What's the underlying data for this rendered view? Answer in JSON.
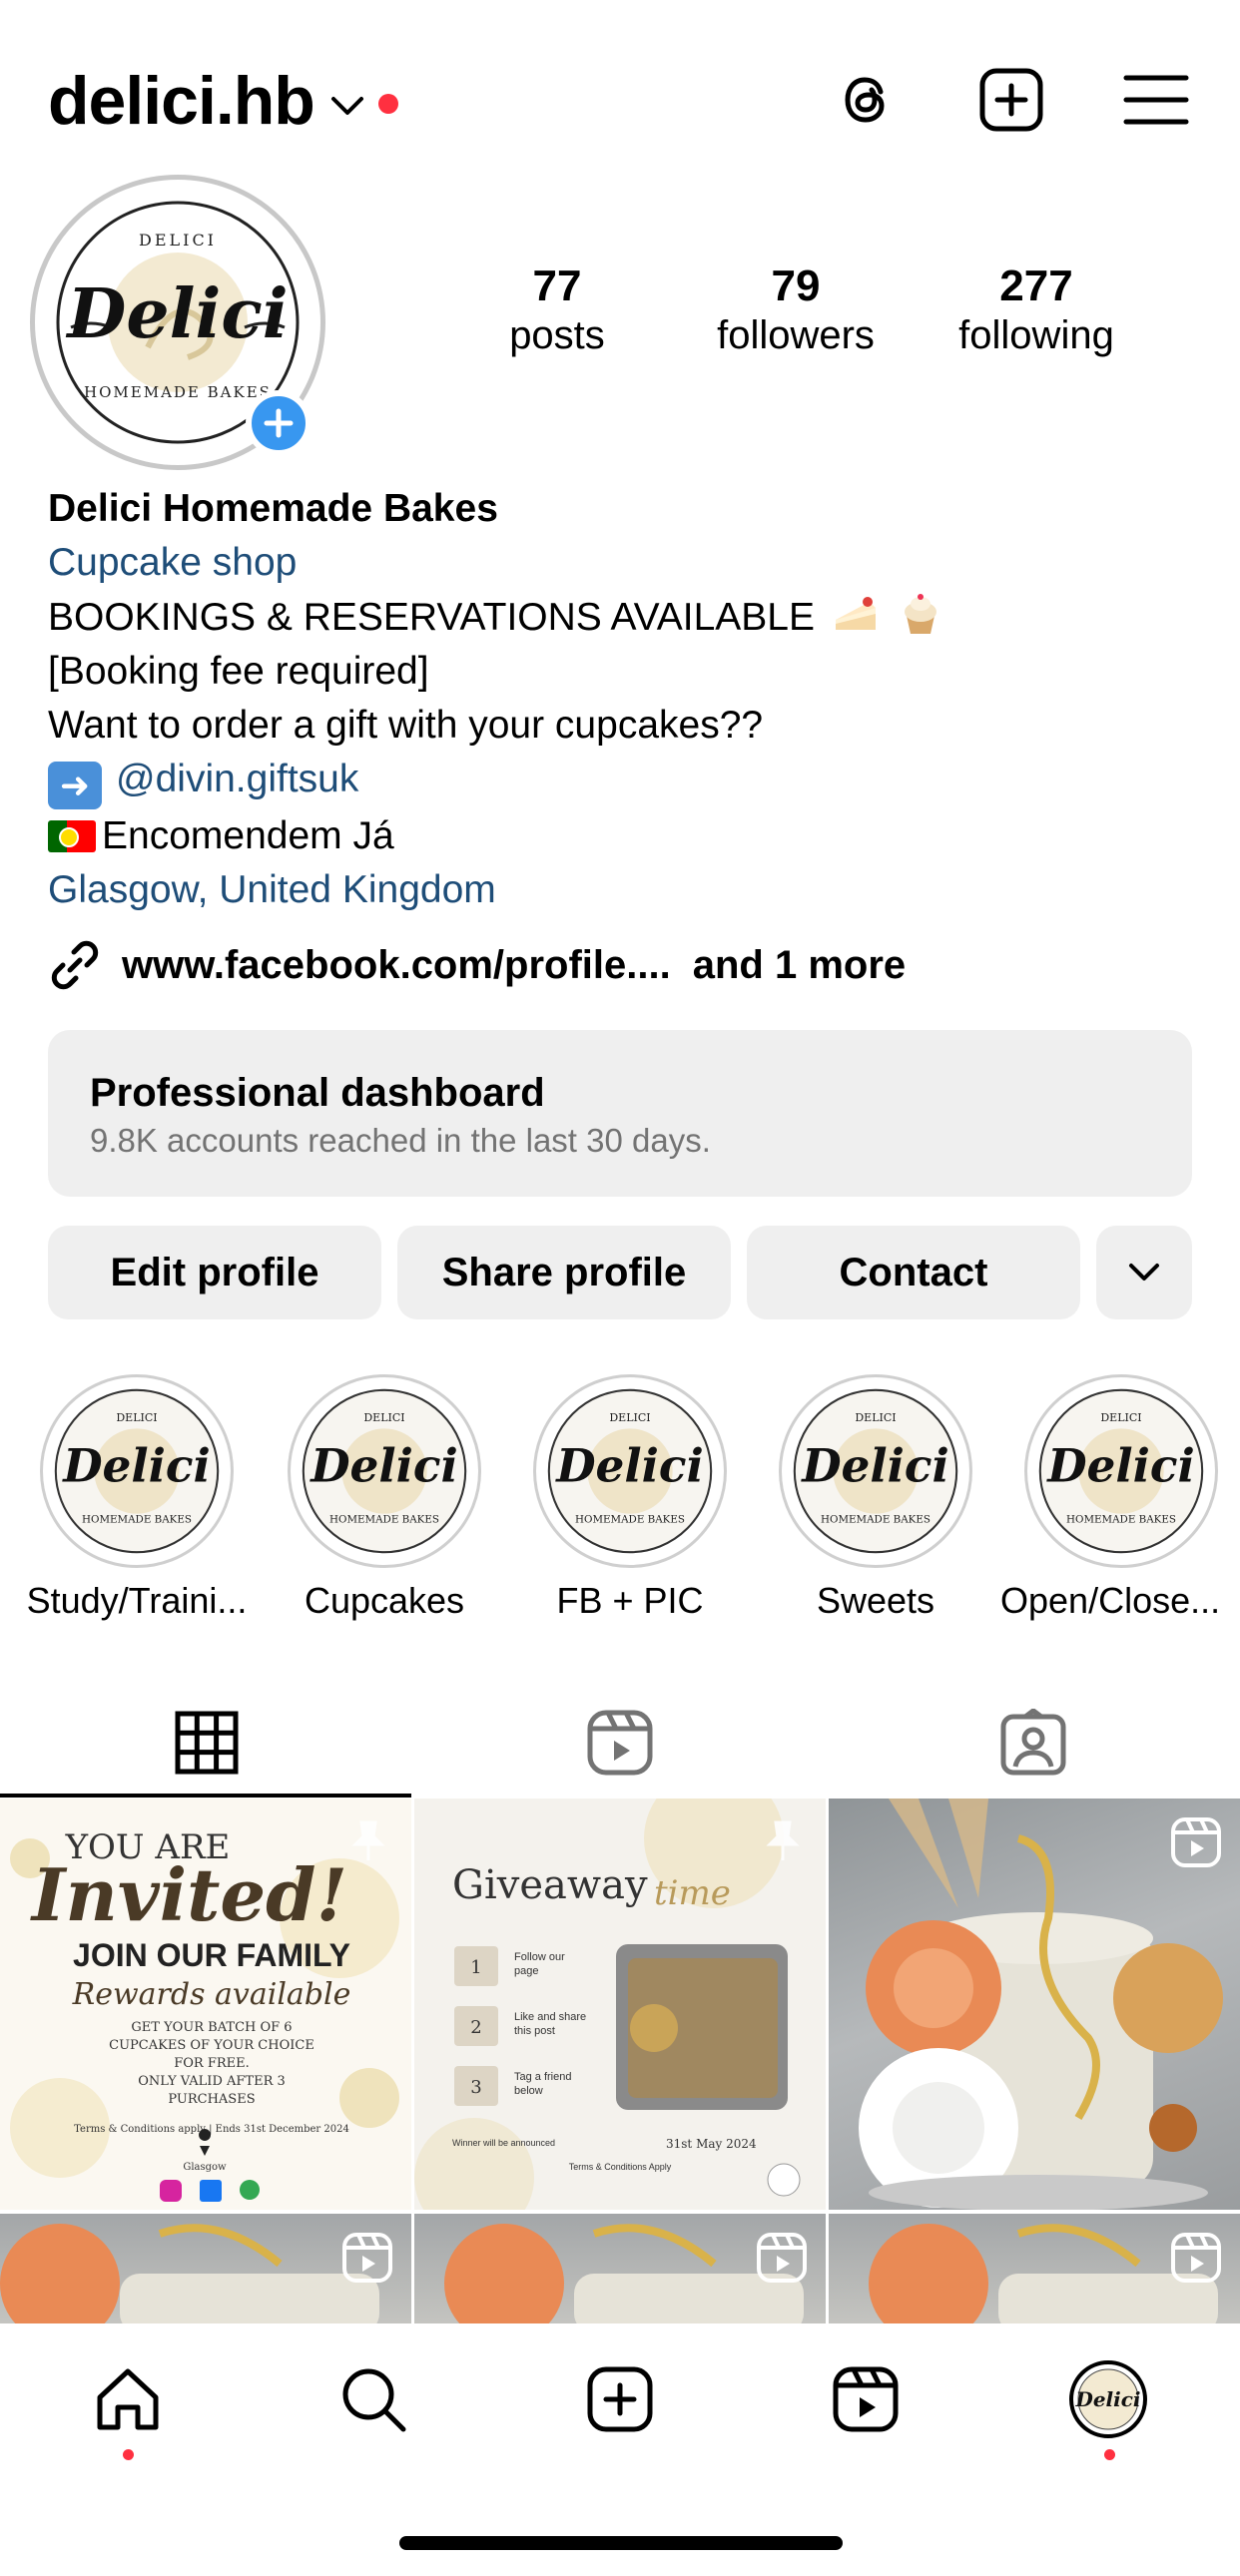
{
  "header": {
    "username": "delici.hb",
    "icons": [
      "threads-icon",
      "create-plus-icon",
      "menu-icon"
    ]
  },
  "profile": {
    "avatar_text": "Delici",
    "avatar_ring_top": "DELICI",
    "avatar_ring_bottom": "HOMEMADE BAKES"
  },
  "stats": {
    "posts_count": "77",
    "posts_label": "posts",
    "followers_count": "79",
    "followers_label": "followers",
    "following_count": "277",
    "following_label": "following"
  },
  "bio": {
    "name": "Delici Homemade Bakes",
    "category": "Cupcake shop",
    "line1": "BOOKINGS & RESERVATIONS AVAILABLE",
    "line2": "[Booking fee required]",
    "line3": "Want to order a gift with your cupcakes??",
    "mention": "@divin.giftsuk",
    "line5": "Encomendem Já",
    "location": "Glasgow, United Kingdom"
  },
  "external_link": {
    "url": "www.facebook.com/profile....",
    "more": "and 1 more"
  },
  "dashboard": {
    "title": "Professional dashboard",
    "subtitle": "9.8K accounts reached in the last 30 days."
  },
  "actions": {
    "edit": "Edit profile",
    "share": "Share profile",
    "contact": "Contact"
  },
  "highlights": [
    {
      "label": "Study/Traini..."
    },
    {
      "label": "Cupcakes"
    },
    {
      "label": "FB + PIC"
    },
    {
      "label": "Sweets"
    },
    {
      "label": "Open/Close..."
    }
  ],
  "posts": {
    "post1": {
      "l1": "YOU ARE",
      "l2": "Invited!",
      "l3": "JOIN OUR FAMILY",
      "l4": "Rewards available",
      "l5": "GET YOUR BATCH OF 6",
      "l6": "CUPCAKES OF YOUR CHOICE",
      "l7": "FOR FREE.",
      "l8": "ONLY VALID AFTER 3",
      "l9": "PURCHASES",
      "l10": "Terms & Conditions apply | Ends 31st December 2024",
      "l11": "Glasgow"
    },
    "post2": {
      "title": "Giveaway",
      "script": "time",
      "steps": [
        {
          "n": "1",
          "t1": "Follow our",
          "t2": "page"
        },
        {
          "n": "2",
          "t1": "Like and share",
          "t2": "this post"
        },
        {
          "n": "3",
          "t1": "Tag a friend",
          "t2": "below"
        }
      ],
      "winner": "Winner will be announced",
      "date": "31st May 2024",
      "terms": "Terms & Conditions Apply"
    }
  },
  "colors": {
    "link": "#1e4d78",
    "notif": "#ff3040",
    "badge": "#3897f0",
    "button_bg": "#efefef"
  }
}
